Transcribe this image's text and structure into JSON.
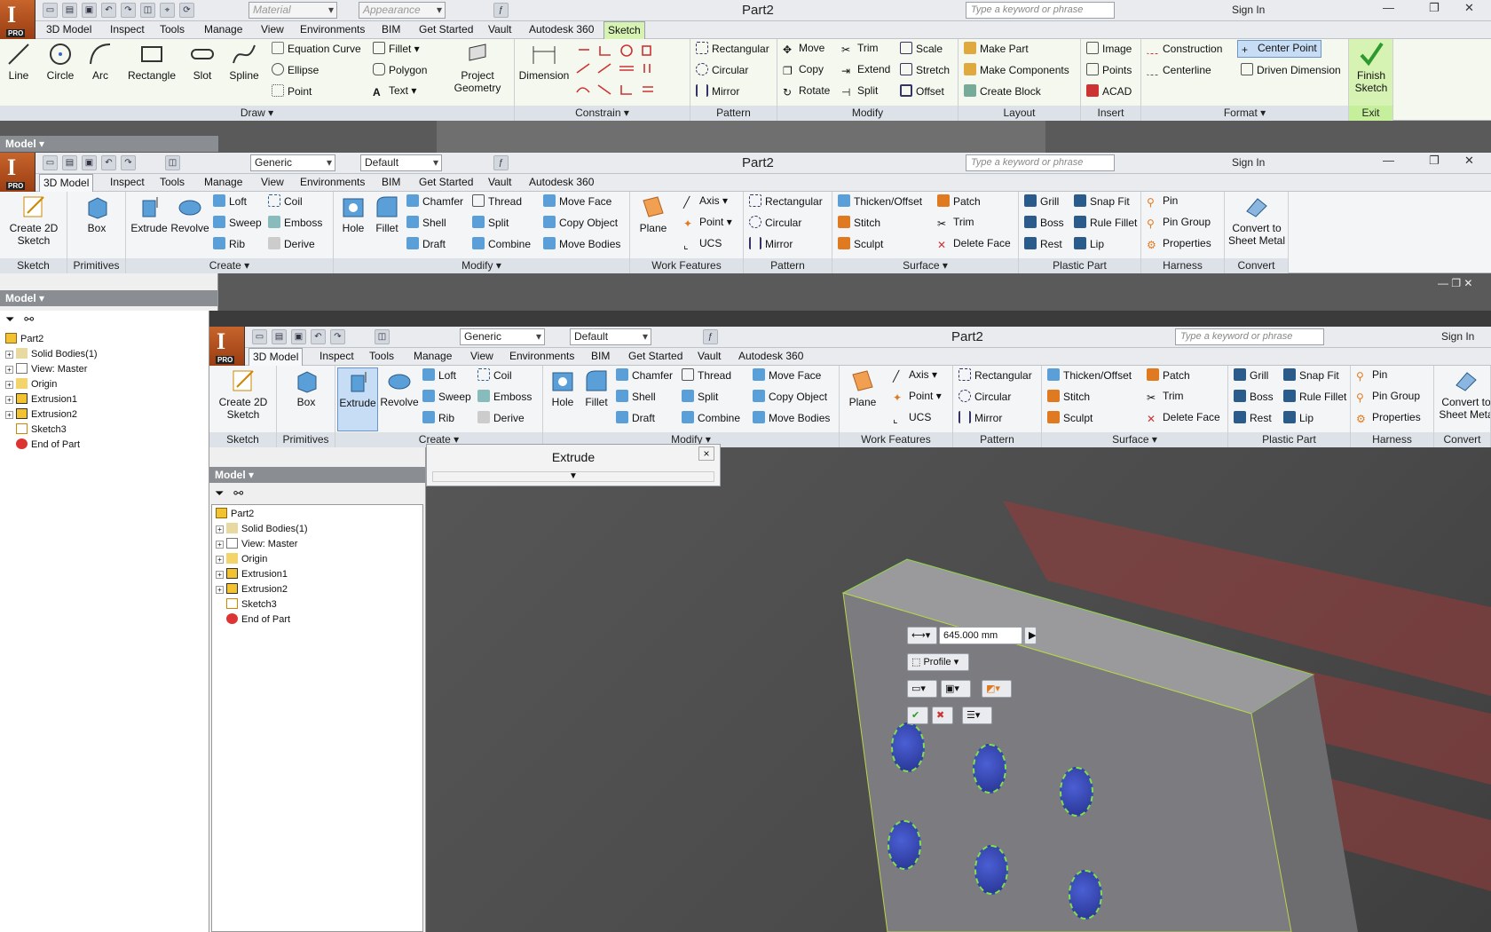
{
  "app_title": "Part2",
  "quick_access": {
    "material": "Material",
    "appearance": "Appearance",
    "material_generic": "Generic",
    "appearance_default": "Default",
    "search_placeholder": "Type a keyword or phrase",
    "sign_in": "Sign In",
    "help": "?",
    "logo_letter": "I",
    "logo_badge": "PRO"
  },
  "window1": {
    "tabs": [
      "3D Model",
      "Inspect",
      "Tools",
      "Manage",
      "View",
      "Environments",
      "BIM",
      "Get Started",
      "Vault",
      "Autodesk 360",
      "Sketch"
    ],
    "active_tab": "Sketch",
    "draw": {
      "label": "Draw",
      "line": "Line",
      "circle": "Circle",
      "arc": "Arc",
      "rectangle": "Rectangle",
      "slot": "Slot",
      "spline": "Spline",
      "equation_curve": "Equation Curve",
      "ellipse": "Ellipse",
      "point": "Point",
      "fillet": "Fillet",
      "polygon": "Polygon",
      "text": "Text",
      "project_geometry": "Project Geometry"
    },
    "constrain": {
      "label": "Constrain",
      "dimension": "Dimension"
    },
    "pattern": {
      "label": "Pattern",
      "rectangular": "Rectangular",
      "circular": "Circular",
      "mirror": "Mirror"
    },
    "modify": {
      "label": "Modify",
      "move": "Move",
      "copy": "Copy",
      "rotate": "Rotate",
      "trim": "Trim",
      "extend": "Extend",
      "split": "Split",
      "scale": "Scale",
      "stretch": "Stretch",
      "offset": "Offset"
    },
    "layout": {
      "label": "Layout",
      "make_part": "Make Part",
      "make_components": "Make Components",
      "create_block": "Create Block"
    },
    "insert": {
      "label": "Insert",
      "image": "Image",
      "points": "Points",
      "acad": "ACAD"
    },
    "format": {
      "label": "Format",
      "construction": "Construction",
      "centerline": "Centerline",
      "center_point": "Center Point",
      "driven_dimension": "Driven Dimension"
    },
    "exit": {
      "label": "Exit",
      "finish_sketch": "Finish Sketch"
    },
    "browser_title": "Model"
  },
  "ribbon3d": {
    "tabs": [
      "3D Model",
      "Inspect",
      "Tools",
      "Manage",
      "View",
      "Environments",
      "BIM",
      "Get Started",
      "Vault",
      "Autodesk 360"
    ],
    "active_tab": "3D Model",
    "sketch": {
      "label": "Sketch",
      "create_2d_sketch": "Create 2D Sketch"
    },
    "primitives": {
      "label": "Primitives",
      "box": "Box"
    },
    "create": {
      "label": "Create",
      "extrude": "Extrude",
      "revolve": "Revolve",
      "loft": "Loft",
      "sweep": "Sweep",
      "rib": "Rib",
      "coil": "Coil",
      "emboss": "Emboss",
      "derive": "Derive"
    },
    "modify": {
      "label": "Modify",
      "hole": "Hole",
      "fillet": "Fillet",
      "chamfer": "Chamfer",
      "shell": "Shell",
      "draft": "Draft",
      "thread": "Thread",
      "split": "Split",
      "combine": "Combine",
      "move_face": "Move Face",
      "copy_object": "Copy Object",
      "move_bodies": "Move Bodies"
    },
    "work_features": {
      "label": "Work Features",
      "plane": "Plane",
      "axis": "Axis",
      "point": "Point",
      "ucs": "UCS"
    },
    "pattern": {
      "label": "Pattern",
      "rectangular": "Rectangular",
      "circular": "Circular",
      "mirror": "Mirror"
    },
    "surface": {
      "label": "Surface",
      "thicken_offset": "Thicken/Offset",
      "stitch": "Stitch",
      "sculpt": "Sculpt",
      "patch": "Patch",
      "trim": "Trim",
      "delete_face": "Delete Face"
    },
    "plastic_part": {
      "label": "Plastic Part",
      "grill": "Grill",
      "boss": "Boss",
      "rest": "Rest",
      "snap_fit": "Snap Fit",
      "rule_fillet": "Rule Fillet",
      "lip": "Lip"
    },
    "harness": {
      "label": "Harness",
      "pin": "Pin",
      "pin_group": "Pin Group",
      "properties": "Properties"
    },
    "convert": {
      "label": "Convert",
      "convert_sheet_metal": "Convert to Sheet Metal",
      "convert_sheet_metal_cut": "Convert to Sheet Meta"
    }
  },
  "browser": {
    "title": "Model",
    "items": [
      "Part2",
      "Solid Bodies(1)",
      "View: Master",
      "Origin",
      "Extrusion1",
      "Extrusion2",
      "Sketch3",
      "End of Part"
    ]
  },
  "extrude_dialog": {
    "title": "Extrude",
    "close": "×"
  },
  "minitoolbar": {
    "distance": "645.000 mm",
    "profile": "Profile"
  },
  "colors": {
    "accent_green": "#c6ef9b",
    "hole_blue": "#3545b8",
    "profile_green": "#7ee04a"
  }
}
